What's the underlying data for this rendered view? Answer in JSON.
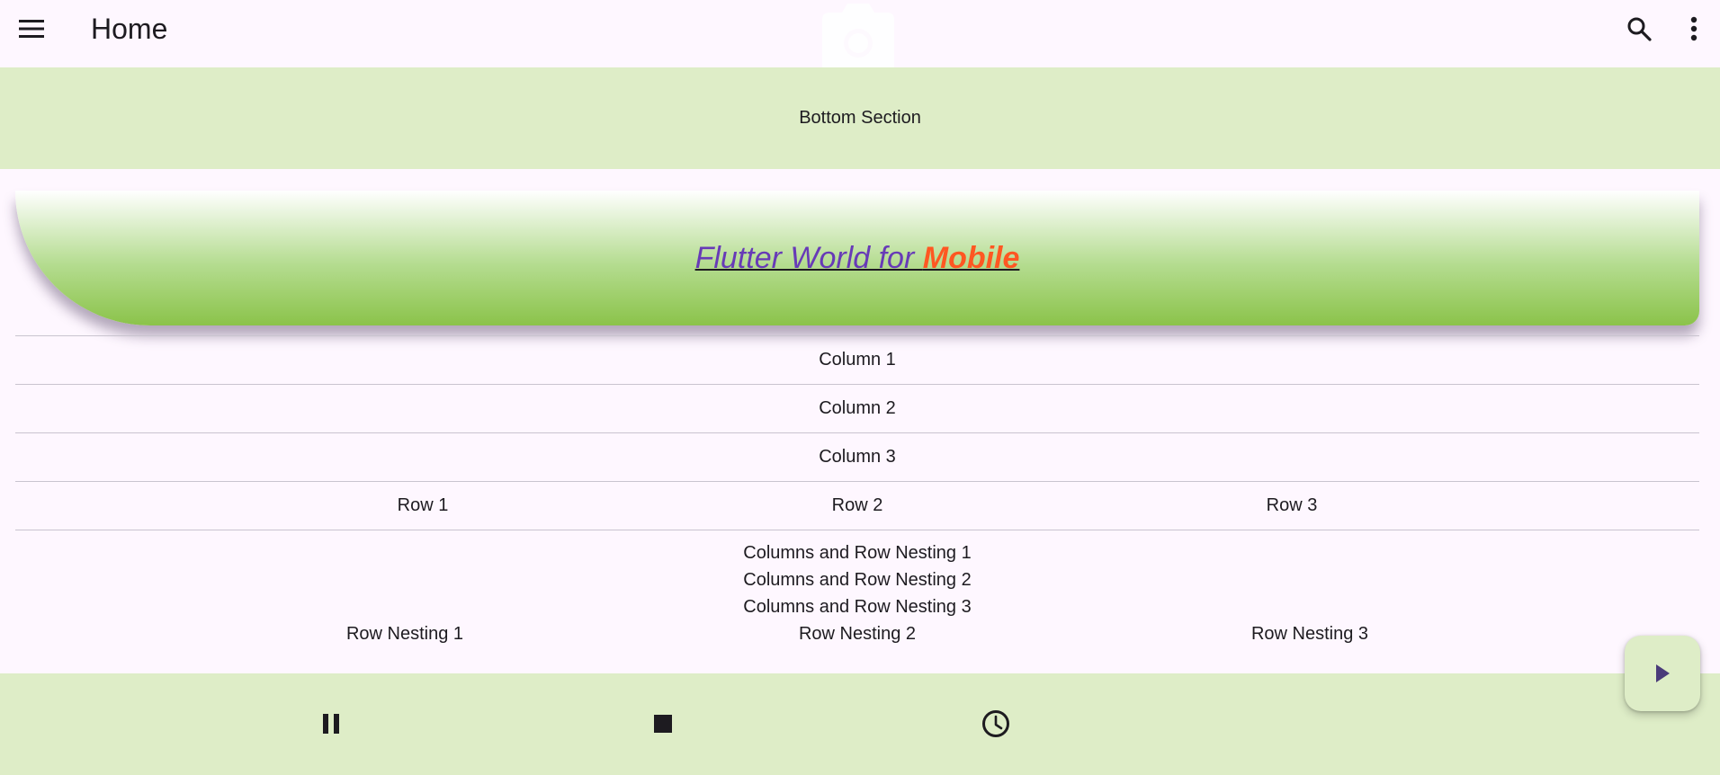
{
  "appbar": {
    "title": "Home",
    "icons": [
      "menu-icon",
      "camera-icon",
      "search-icon",
      "more-vert-icon"
    ]
  },
  "bottom_section": {
    "label": "Bottom Section"
  },
  "banner": {
    "text_part1": "Flutter World for ",
    "text_part2": "Mobile",
    "colors": {
      "part1": "#673ab7",
      "part2": "#ff5722",
      "gradient_start": "#ffffff",
      "gradient_end": "#8bc34a"
    }
  },
  "columns": [
    "Column 1",
    "Column 2",
    "Column 3"
  ],
  "rows": [
    "Row 1",
    "Row 2",
    "Row 3"
  ],
  "nesting": {
    "columns": [
      "Columns and Row Nesting 1",
      "Columns and Row Nesting 2",
      "Columns and Row Nesting 3"
    ],
    "rows": [
      "Row Nesting 1",
      "Row Nesting 2",
      "Row Nesting 3"
    ]
  },
  "bottom_bar": {
    "icons": [
      "pause-icon",
      "stop-icon",
      "clock-icon"
    ]
  },
  "fab": {
    "icon": "play-icon"
  },
  "colors": {
    "background": "#fef7ff",
    "section": "#deedc7",
    "accent": "#4a3b7a"
  }
}
